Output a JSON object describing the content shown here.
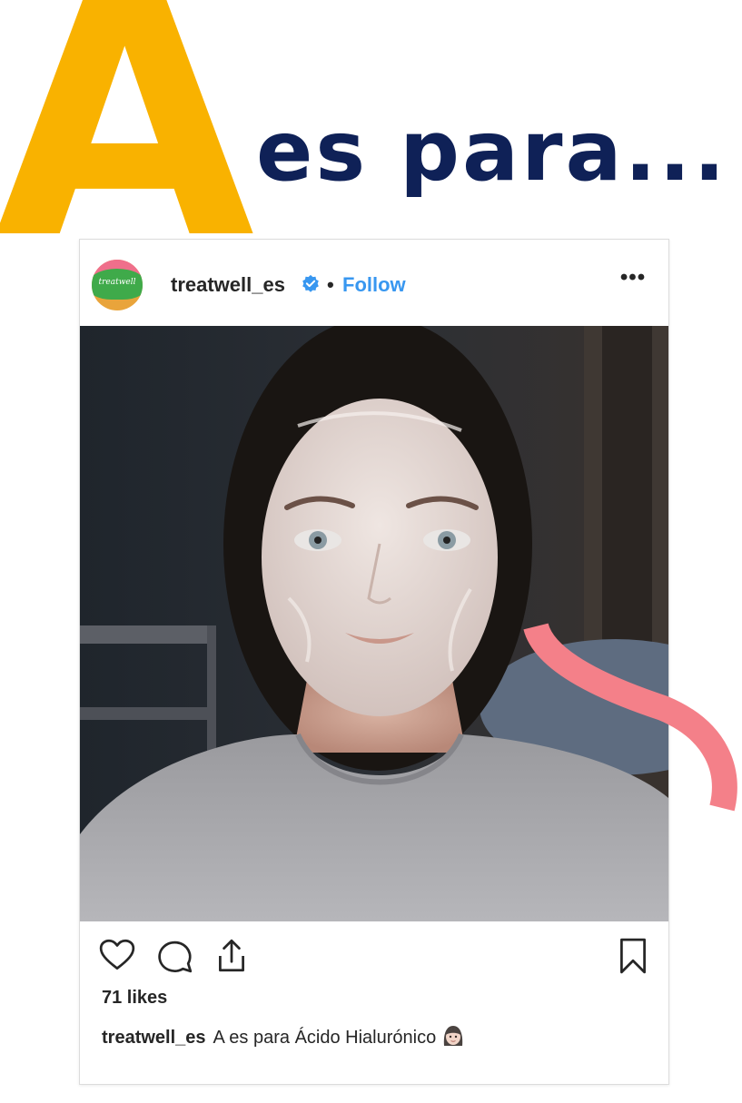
{
  "headline": {
    "letter": "A",
    "text": "es para..."
  },
  "post": {
    "avatar_text": "treatwell",
    "username": "treatwell_es",
    "separator": "•",
    "follow_label": "Follow",
    "more_label": "•••",
    "likes": "71 likes",
    "caption_user": "treatwell_es",
    "caption_text": "A es para Ácido Hialurónico"
  },
  "icons": {
    "verified": "verified-badge-icon",
    "like": "heart-icon",
    "comment": "comment-icon",
    "share": "share-icon",
    "save": "bookmark-icon",
    "emoji": "woman-face-emoji-icon"
  },
  "colors": {
    "letter": "#f9b200",
    "headline": "#0f2157",
    "follow": "#3897f0",
    "swoosh": "#f48089"
  }
}
